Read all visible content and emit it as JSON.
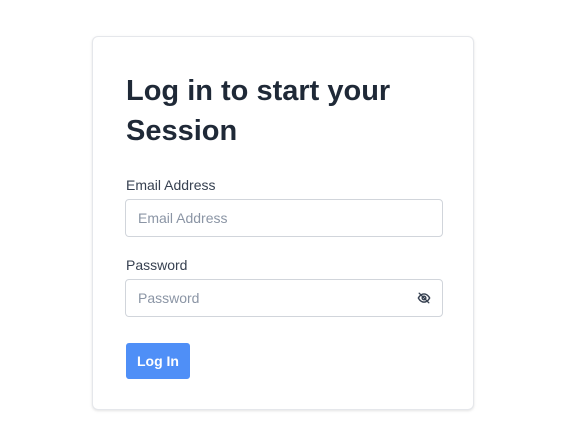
{
  "login": {
    "title": "Log in to start your Session",
    "email": {
      "label": "Email Address",
      "placeholder": "Email Address",
      "value": ""
    },
    "password": {
      "label": "Password",
      "placeholder": "Password",
      "value": "",
      "toggle_icon": "eye-slash-icon"
    },
    "submit_label": "Log In"
  },
  "colors": {
    "primary": "#4f8ff7",
    "heading": "#1f2937",
    "border": "#d1d5db"
  }
}
